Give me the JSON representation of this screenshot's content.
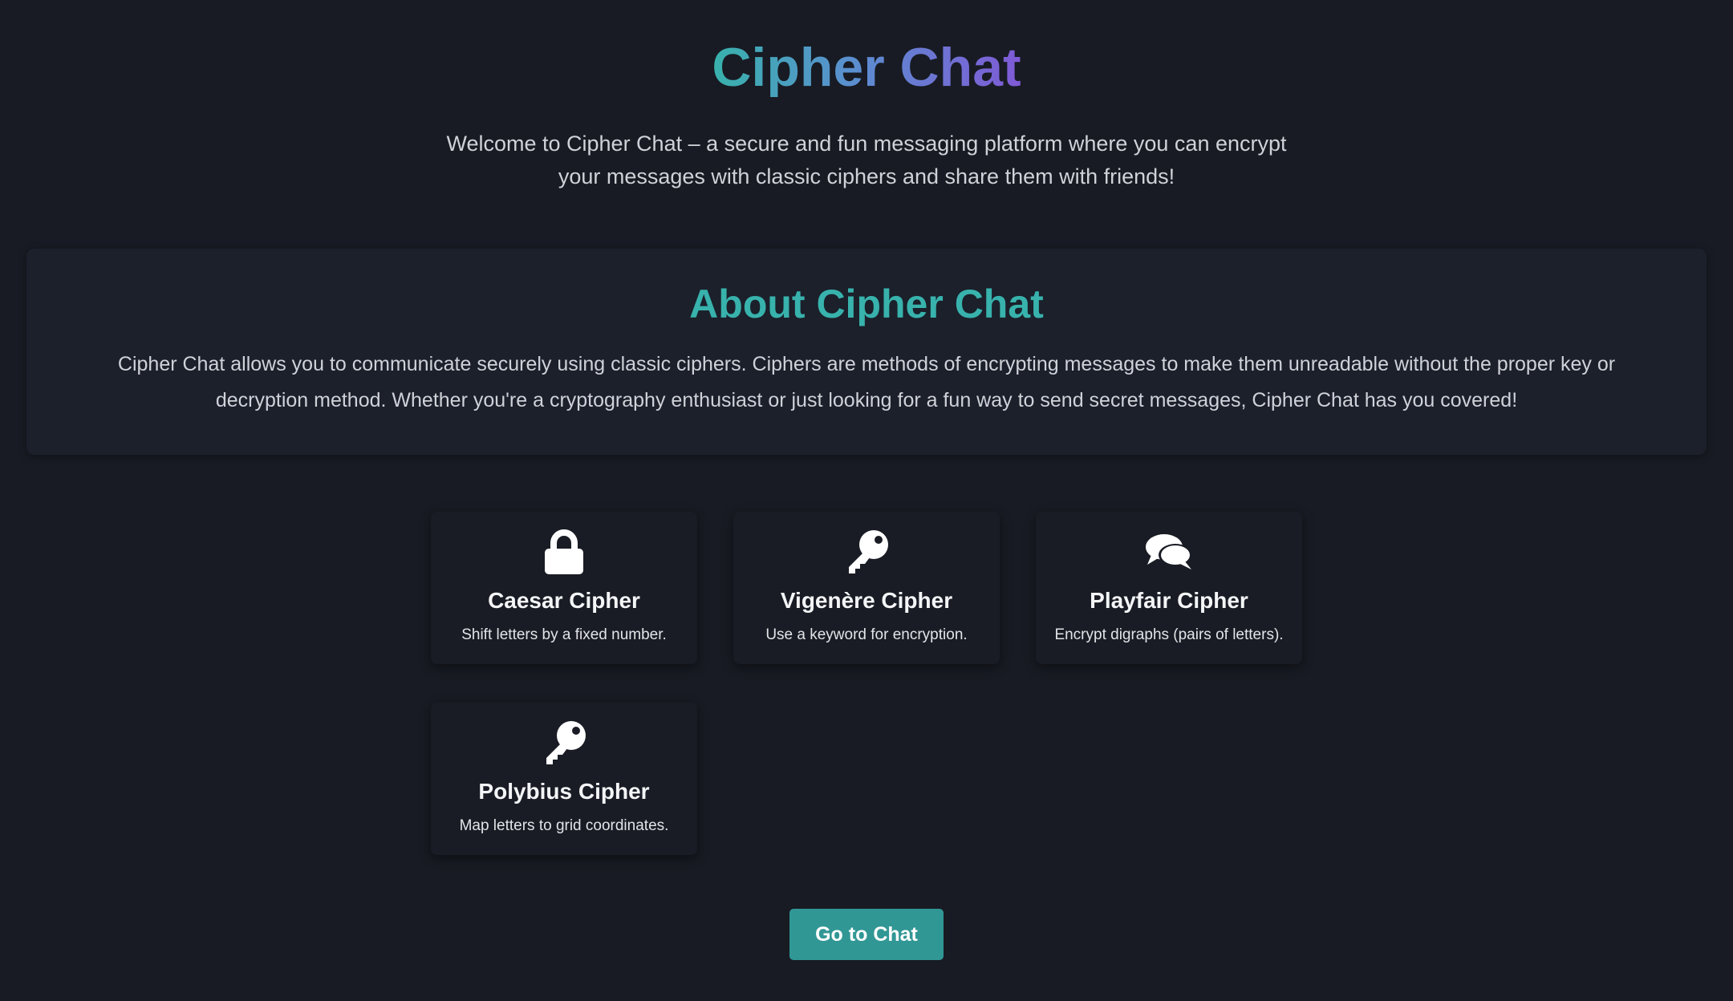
{
  "hero": {
    "title": "Cipher Chat",
    "subtitle": "Welcome to Cipher Chat – a secure and fun messaging platform where you can encrypt your messages with classic ciphers and share them with friends!"
  },
  "about": {
    "title": "About Cipher Chat",
    "text": "Cipher Chat allows you to communicate securely using classic ciphers. Ciphers are methods of encrypting messages to make them unreadable without the proper key or decryption method. Whether you're a cryptography enthusiast or just looking for a fun way to send secret messages, Cipher Chat has you covered!"
  },
  "ciphers": [
    {
      "name": "Caesar Cipher",
      "description": "Shift letters by a fixed number.",
      "icon": "lock-icon"
    },
    {
      "name": "Vigenère Cipher",
      "description": "Use a keyword for encryption.",
      "icon": "key-icon"
    },
    {
      "name": "Playfair Cipher",
      "description": "Encrypt digraphs (pairs of letters).",
      "icon": "comments-icon"
    },
    {
      "name": "Polybius Cipher",
      "description": "Map letters to grid coordinates.",
      "icon": "key-icon"
    }
  ],
  "cta": {
    "label": "Go to Chat"
  },
  "colors": {
    "background": "#181b23",
    "panel": "#1b202b",
    "accent": "#38b2ac",
    "button": "#319795",
    "gradient_end": "#7f5ad6"
  }
}
